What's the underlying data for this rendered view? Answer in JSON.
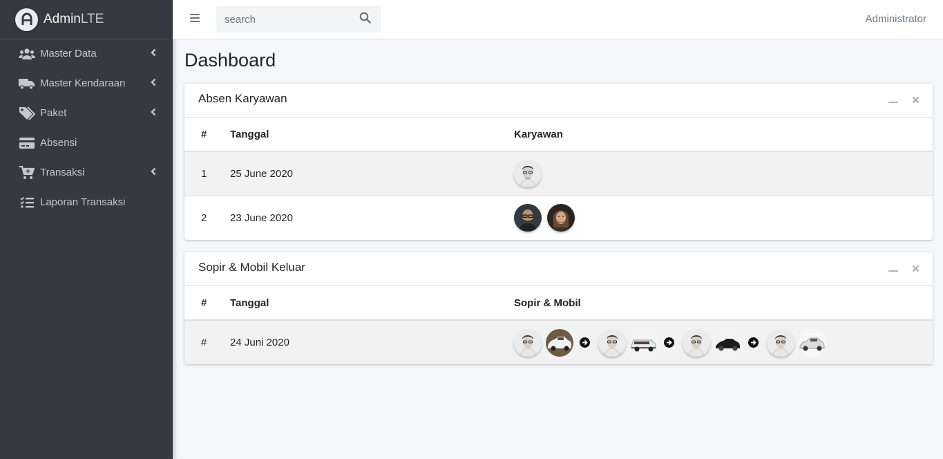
{
  "brand": {
    "name_bold": "Admin",
    "name_light": "LTE",
    "logo_icon": "adminlte-logo-icon"
  },
  "sidebar": {
    "items": [
      {
        "label": "Master Data",
        "icon": "users-icon",
        "has_submenu": true
      },
      {
        "label": "Master Kendaraan",
        "icon": "truck-icon",
        "has_submenu": true
      },
      {
        "label": "Paket",
        "icon": "tags-icon",
        "has_submenu": true
      },
      {
        "label": "Absensi",
        "icon": "credit-card-icon",
        "has_submenu": false
      },
      {
        "label": "Transaksi",
        "icon": "cart-plus-icon",
        "has_submenu": true
      },
      {
        "label": "Laporan Transaksi",
        "icon": "tasks-icon",
        "has_submenu": false
      }
    ]
  },
  "topbar": {
    "search_placeholder": "search",
    "user": "Administrator"
  },
  "page": {
    "title": "Dashboard"
  },
  "absen_card": {
    "title": "Absen Karyawan",
    "columns": [
      "#",
      "Tanggal",
      "Karyawan"
    ],
    "rows": [
      {
        "no": "1",
        "date": "25 June 2020",
        "employees": [
          "avatar-man-glasses"
        ]
      },
      {
        "no": "2",
        "date": "23 June 2020",
        "employees": [
          "avatar-man-beard",
          "avatar-man-long-hair"
        ]
      }
    ]
  },
  "sopir_card": {
    "title": "Sopir & Mobil Keluar",
    "columns": [
      "#",
      "Tanggal",
      "Sopir & Mobil"
    ],
    "rows": [
      {
        "no": "#",
        "date": "24 Juni 2020",
        "pairs": [
          {
            "driver": "avatar-man-glasses",
            "car": "white-suv"
          },
          {
            "driver": "avatar-man-glasses",
            "car": "white-red-van"
          },
          {
            "driver": "avatar-man-glasses",
            "car": "black-sedan"
          },
          {
            "driver": "avatar-man-glasses",
            "car": "silver-mpv"
          }
        ]
      }
    ]
  },
  "colors": {
    "sidebar_bg": "#343a40",
    "sidebar_text": "#c2c7d0",
    "content_bg": "#f4f6f9"
  }
}
